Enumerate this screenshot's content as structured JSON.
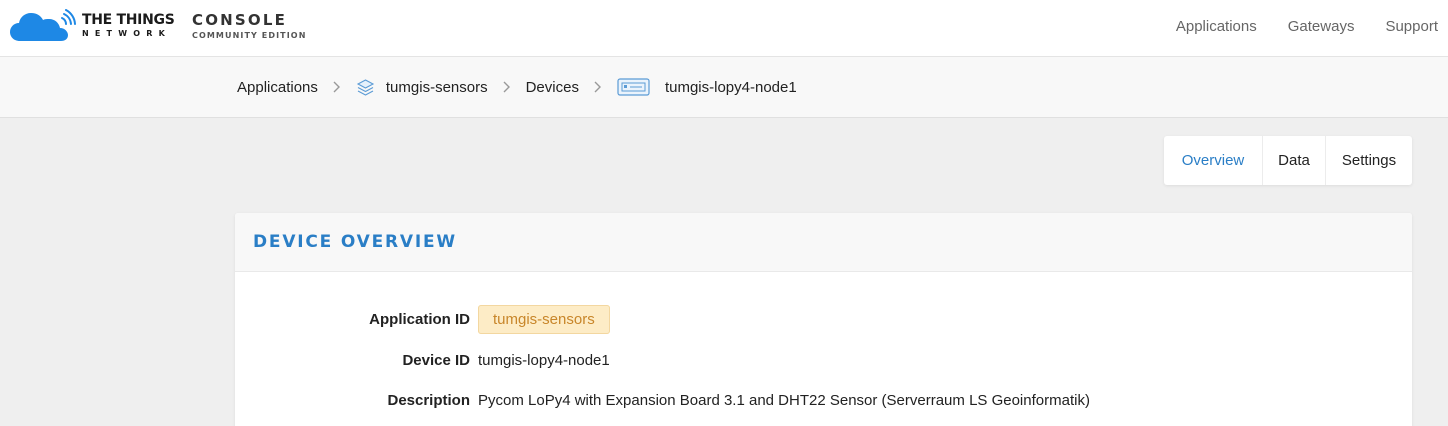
{
  "header": {
    "brand_main": "THE THINGS",
    "brand_sub": "NETWORK",
    "console_title": "CONSOLE",
    "console_subtitle": "COMMUNITY EDITION",
    "nav": [
      "Applications",
      "Gateways",
      "Support"
    ],
    "logo_color": "#1e88e5"
  },
  "breadcrumb": {
    "items": [
      {
        "label": "Applications",
        "icon": ""
      },
      {
        "label": "tumgis-sensors",
        "icon": "stack-icon"
      },
      {
        "label": "Devices",
        "icon": ""
      },
      {
        "label": "tumgis-lopy4-node1",
        "icon": "device-icon"
      }
    ],
    "separator": "chevron-right-icon"
  },
  "tabs": {
    "items": [
      "Overview",
      "Data",
      "Settings"
    ],
    "active": "Overview"
  },
  "device_overview": {
    "title": "DEVICE OVERVIEW",
    "fields": {
      "application_id_label": "Application ID",
      "application_id": "tumgis-sensors",
      "device_id_label": "Device ID",
      "device_id": "tumgis-lopy4-node1",
      "description_label": "Description",
      "description": "Pycom LoPy4 with Expansion Board 3.1 and DHT22 Sensor (Serverraum LS Geoinformatik)"
    }
  },
  "colors": {
    "accent": "#2a7ec6",
    "pill_bg": "#fdecc6",
    "pill_text": "#c8862a"
  }
}
